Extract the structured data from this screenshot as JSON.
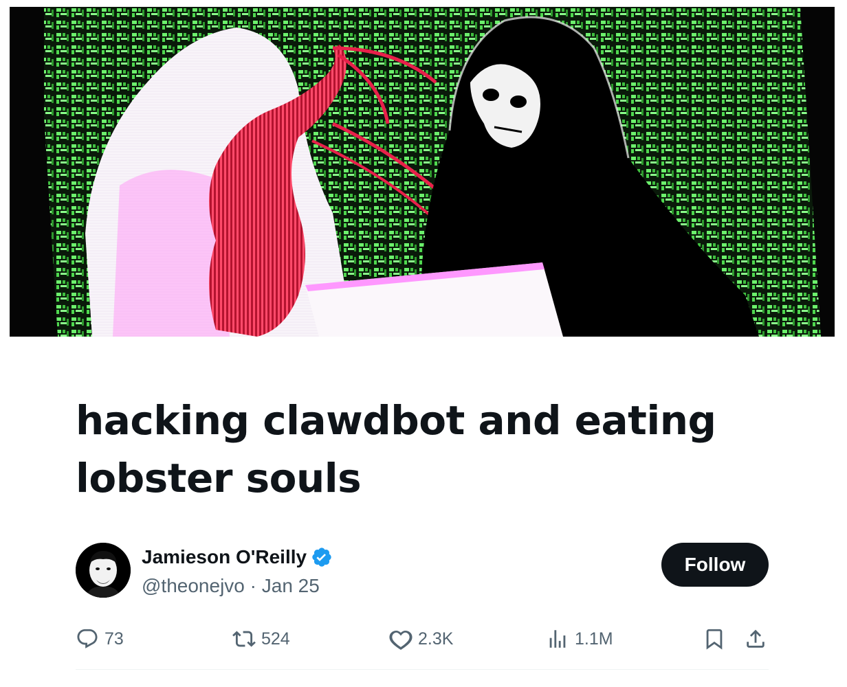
{
  "article": {
    "title": "hacking clawdbot and eating lobster souls"
  },
  "author": {
    "name": "Jamieson O'Reilly",
    "handle": "@theonejvo",
    "separator": " · ",
    "date": "Jan 25",
    "verified": true,
    "verified_color": "#1d9bf0"
  },
  "follow_button": {
    "label": "Follow"
  },
  "actions": {
    "replies": "73",
    "reposts": "524",
    "likes": "2.3K",
    "views": "1.1M"
  },
  "icons": {
    "reply": "speech-bubble-icon",
    "repost": "repost-arrows-icon",
    "like": "heart-icon",
    "views": "bar-chart-icon",
    "bookmark": "bookmark-icon",
    "share": "share-upload-icon"
  },
  "colors": {
    "text_primary": "#0f1419",
    "text_secondary": "#536471",
    "follow_bg": "#0f1419",
    "cover_matrix_green": "#6cf06c",
    "cover_lobster_red": "#e8204a",
    "cover_magenta": "#ff5cff"
  }
}
